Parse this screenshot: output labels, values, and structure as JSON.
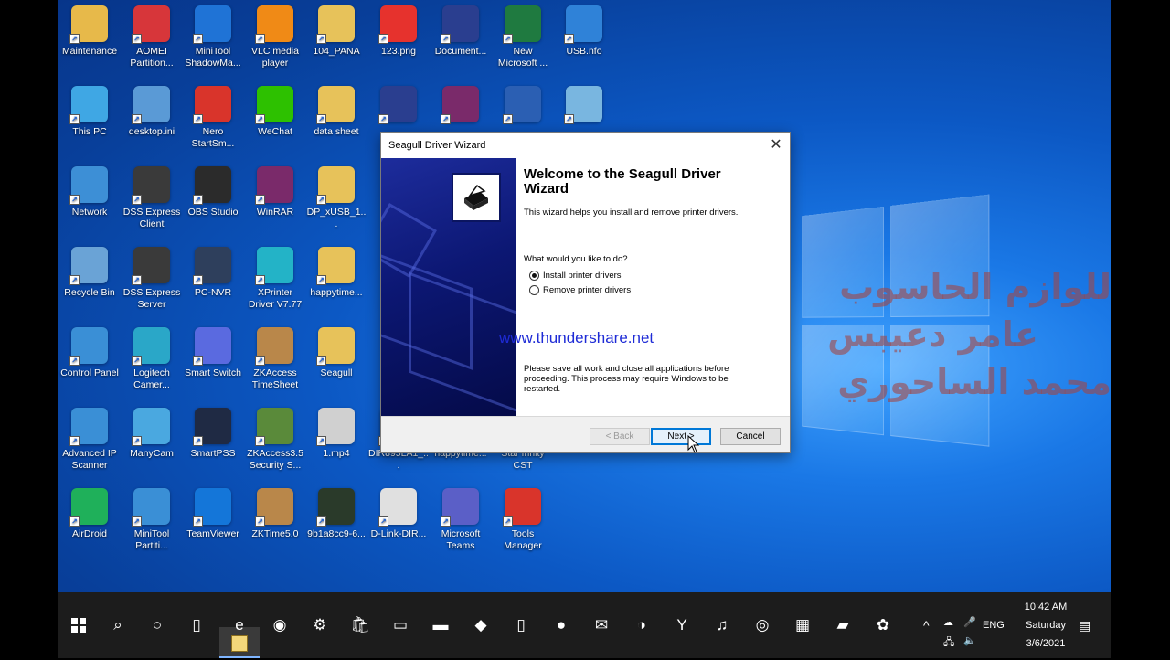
{
  "desktop": {
    "icons": [
      {
        "label": "Maintenance",
        "icon": "folder-user-icon",
        "color": "#e7b94a"
      },
      {
        "label": "AOMEI Partition...",
        "icon": "aomei-icon",
        "color": "#d7363a"
      },
      {
        "label": "MiniTool ShadowMa...",
        "icon": "minitool-shadow-icon",
        "color": "#1f73d6"
      },
      {
        "label": "VLC media player",
        "icon": "vlc-cone-icon",
        "color": "#f08a16"
      },
      {
        "label": "104_PANA",
        "icon": "folder-icon",
        "color": "#e7c25a"
      },
      {
        "label": "123.png",
        "icon": "cse-image-icon",
        "color": "#e6322d"
      },
      {
        "label": "Document...",
        "icon": "bartender-doc-icon",
        "color": "#2a3e8f"
      },
      {
        "label": "New Microsoft ...",
        "icon": "excel-icon",
        "color": "#1f7a40"
      },
      {
        "label": "USB.nfo",
        "icon": "system-info-icon",
        "color": "#2f82d8"
      },
      {
        "label": "This PC",
        "icon": "computer-icon",
        "color": "#3fa7e4"
      },
      {
        "label": "desktop.ini",
        "icon": "settings-file-icon",
        "color": "#5a9ad6"
      },
      {
        "label": "Nero StartSm...",
        "icon": "nero-icon",
        "color": "#d9342b"
      },
      {
        "label": "WeChat",
        "icon": "wechat-icon",
        "color": "#2dc100"
      },
      {
        "label": "data sheet",
        "icon": "folder-pdf-icon",
        "color": "#e7c25a"
      },
      {
        "label": "",
        "icon": "bartender-icon",
        "color": "#2a3e8f"
      },
      {
        "label": "",
        "icon": "winrar-icon",
        "color": "#7a2a6a"
      },
      {
        "label": "",
        "icon": "word-icon",
        "color": "#2b5fb3"
      },
      {
        "label": "",
        "icon": "install-icon",
        "color": "#79b6e0"
      },
      {
        "label": "Network",
        "icon": "network-icon",
        "color": "#3d8fd6"
      },
      {
        "label": "DSS Express Client",
        "icon": "dss-client-icon",
        "color": "#3a3a3a"
      },
      {
        "label": "OBS Studio",
        "icon": "obs-icon",
        "color": "#2b2b2b"
      },
      {
        "label": "WinRAR",
        "icon": "winrar-icon",
        "color": "#7a2a6a"
      },
      {
        "label": "DP_xUSB_1...",
        "icon": "folder-chrome-icon",
        "color": "#e7c25a"
      },
      {
        "label": "Recycle Bin",
        "icon": "recycle-bin-icon",
        "color": "#6aa3d6"
      },
      {
        "label": "DSS Express Server",
        "icon": "dss-server-icon",
        "color": "#3a3a3a"
      },
      {
        "label": "PC-NVR",
        "icon": "pc-nvr-icon",
        "color": "#2e3f5c"
      },
      {
        "label": "XPrinter Driver V7.77",
        "icon": "xprinter-icon",
        "color": "#23b3c7"
      },
      {
        "label": "happytime...",
        "icon": "folder-icon",
        "color": "#e7c25a"
      },
      {
        "label": "Control Panel",
        "icon": "control-panel-icon",
        "color": "#3a8fd6"
      },
      {
        "label": "Logitech Camer...",
        "icon": "logitech-camera-icon",
        "color": "#2aa7c8"
      },
      {
        "label": "Smart Switch",
        "icon": "smart-switch-icon",
        "color": "#5a6ae0"
      },
      {
        "label": "ZKAccess TimeSheet",
        "icon": "zkaccess-icon",
        "color": "#b9874a"
      },
      {
        "label": "Seagull",
        "icon": "folder-icon",
        "color": "#e7c25a"
      },
      {
        "label": "Advanced IP Scanner",
        "icon": "ip-scanner-icon",
        "color": "#3a8fd6"
      },
      {
        "label": "ManyCam",
        "icon": "manycam-icon",
        "color": "#4aa8e0"
      },
      {
        "label": "SmartPSS",
        "icon": "smartpss-icon",
        "color": "#1f2a44"
      },
      {
        "label": "ZKAccess3.5 Security S...",
        "icon": "zkaccess-security-icon",
        "color": "#5a8a3a"
      },
      {
        "label": "1.mp4",
        "icon": "video-file-icon",
        "color": "#d0d0d0"
      },
      {
        "label": "DIR895LA1_...",
        "icon": "file-icon",
        "color": "#cfcfcf"
      },
      {
        "label": "happytime...",
        "icon": "file-icon",
        "color": "#cfcfcf"
      },
      {
        "label": "Star Innity CST",
        "icon": "star-icon",
        "color": "#cfcfcf"
      },
      {
        "label": "AirDroid",
        "icon": "airdroid-icon",
        "color": "#1fb05a"
      },
      {
        "label": "MiniTool Partiti...",
        "icon": "minitool-partition-icon",
        "color": "#3a8fd6"
      },
      {
        "label": "TeamViewer",
        "icon": "teamviewer-icon",
        "color": "#1476d9"
      },
      {
        "label": "ZKTime5.0",
        "icon": "zktime-icon",
        "color": "#b9874a"
      },
      {
        "label": "9b1a8cc9-6...",
        "icon": "image-file-icon",
        "color": "#2a3a2a"
      },
      {
        "label": "D-Link-DIR...",
        "icon": "router-icon",
        "color": "#e0e0e0"
      },
      {
        "label": "Microsoft Teams",
        "icon": "teams-icon",
        "color": "#5b5fc7"
      },
      {
        "label": "Tools Manager",
        "icon": "tools-manager-icon",
        "color": "#d9342b"
      }
    ],
    "watermark": {
      "line1": "للوازم الحاسوب",
      "line2": "عامر دعيبس",
      "line3": "محمد الساحوري"
    },
    "url_overlay": "www.thundershare.net"
  },
  "wizard": {
    "title": "Seagull Driver Wizard",
    "heading": "Welcome to the Seagull Driver Wizard",
    "intro": "This wizard helps you install and remove printer drivers.",
    "question": "What would you like to do?",
    "option_install": "Install printer drivers",
    "option_remove": "Remove printer drivers",
    "selected": "install",
    "note": "Please save all work and close all applications before proceeding.  This process may require Windows to be restarted.",
    "back_label": "< Back",
    "next_label": "Next >",
    "cancel_label": "Cancel"
  },
  "taskbar": {
    "apps": [
      "edge-legacy-icon",
      "chrome-icon",
      "network-scanner-icon",
      "store-icon",
      "app-icon",
      "terminal-icon",
      "anydesk-icon",
      "usb-icon",
      "camera-icon",
      "mail-icon",
      "edge-icon",
      "yandex-icon",
      "media-icon",
      "capture-icon",
      "calculator-icon",
      "file-explorer-icon",
      "app-grid-icon"
    ],
    "language": "ENG",
    "time": "10:42 AM",
    "day": "Saturday",
    "date": "3/6/2021"
  }
}
